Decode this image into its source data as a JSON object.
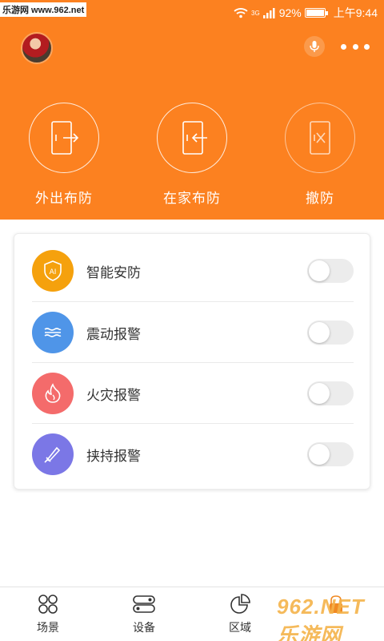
{
  "status": {
    "watermark": "乐游网 www.962.net",
    "network": "3G",
    "battery": "92%",
    "battery_level": 0.92,
    "time": "上午9:44"
  },
  "modes": [
    {
      "label": "外出布防"
    },
    {
      "label": "在家布防"
    },
    {
      "label": "撤防"
    }
  ],
  "alarms": [
    {
      "label": "智能安防",
      "color": "#f5a10d",
      "enabled": false
    },
    {
      "label": "震动报警",
      "color": "#4f95e8",
      "enabled": false
    },
    {
      "label": "火灾报警",
      "color": "#f46b6b",
      "enabled": false
    },
    {
      "label": "挟持报警",
      "color": "#7b77e6",
      "enabled": false
    }
  ],
  "nav": [
    {
      "label": "场景"
    },
    {
      "label": "设备"
    },
    {
      "label": "区域"
    }
  ],
  "brand_watermark": "962.NET 乐游网",
  "colors": {
    "accent": "#fc8120"
  }
}
